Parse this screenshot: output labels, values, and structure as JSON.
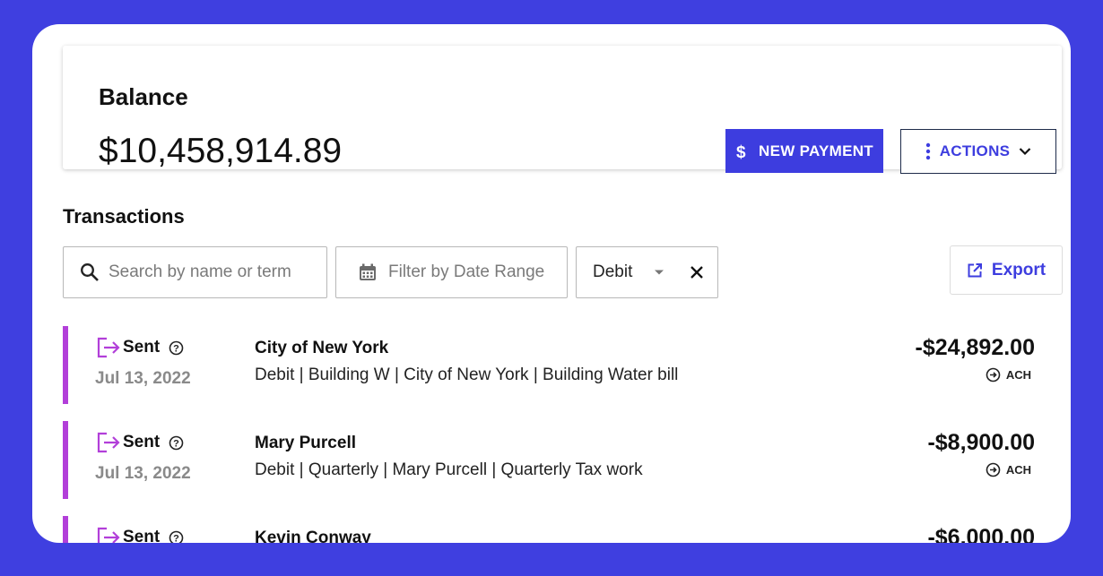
{
  "balance": {
    "title": "Balance",
    "amount": "$10,458,914.89",
    "new_payment_label": "NEW PAYMENT",
    "actions_label": "ACTIONS"
  },
  "transactions": {
    "title": "Transactions",
    "search_placeholder": "Search by name or term",
    "date_placeholder": "Filter by Date Range",
    "type_filter": "Debit",
    "export_label": "Export",
    "items": [
      {
        "status": "Sent",
        "date": "Jul 13, 2022",
        "name": "City of New York",
        "description": "Debit | Building W | City of New York | Building Water bill",
        "amount": "-$24,892.00",
        "method": "ACH"
      },
      {
        "status": "Sent",
        "date": "Jul 13, 2022",
        "name": "Mary Purcell",
        "description": "Debit | Quarterly | Mary Purcell | Quarterly Tax work",
        "amount": "-$8,900.00",
        "method": "ACH"
      },
      {
        "status": "Sent",
        "date": "",
        "name": "Kevin Conway",
        "description": "",
        "amount": "-$6,000.00",
        "method": ""
      }
    ]
  },
  "colors": {
    "background": "#3f3fe0",
    "accent": "#3d3ddf",
    "sent_bar": "#b23fd9"
  },
  "icons": [
    "dollar-icon",
    "more-vert-icon",
    "chevron-down-icon",
    "search-icon",
    "calendar-icon",
    "dropdown-arrow-icon",
    "close-icon",
    "external-link-icon",
    "sent-icon",
    "help-icon",
    "ach-icon"
  ]
}
